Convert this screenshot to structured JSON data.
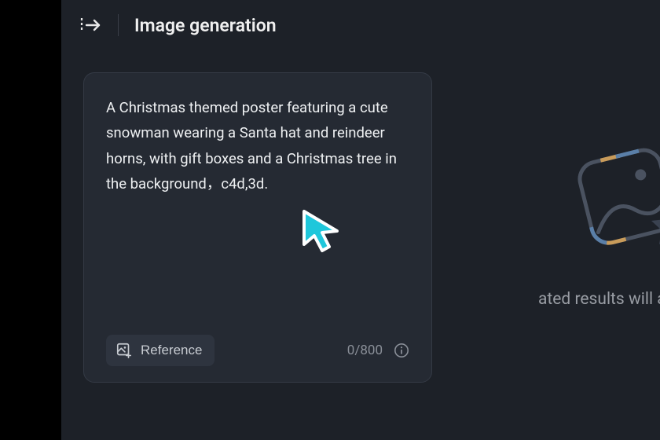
{
  "header": {
    "title": "Image generation"
  },
  "prompt": {
    "text": "A Christmas themed poster featuring a cute snowman wearing a Santa hat and reindeer horns, with gift boxes and a Christmas tree in the background，c4d,3d."
  },
  "footer": {
    "reference_label": "Reference",
    "char_count": "0/800"
  },
  "preview": {
    "placeholder_text": "ated results will appear he"
  }
}
